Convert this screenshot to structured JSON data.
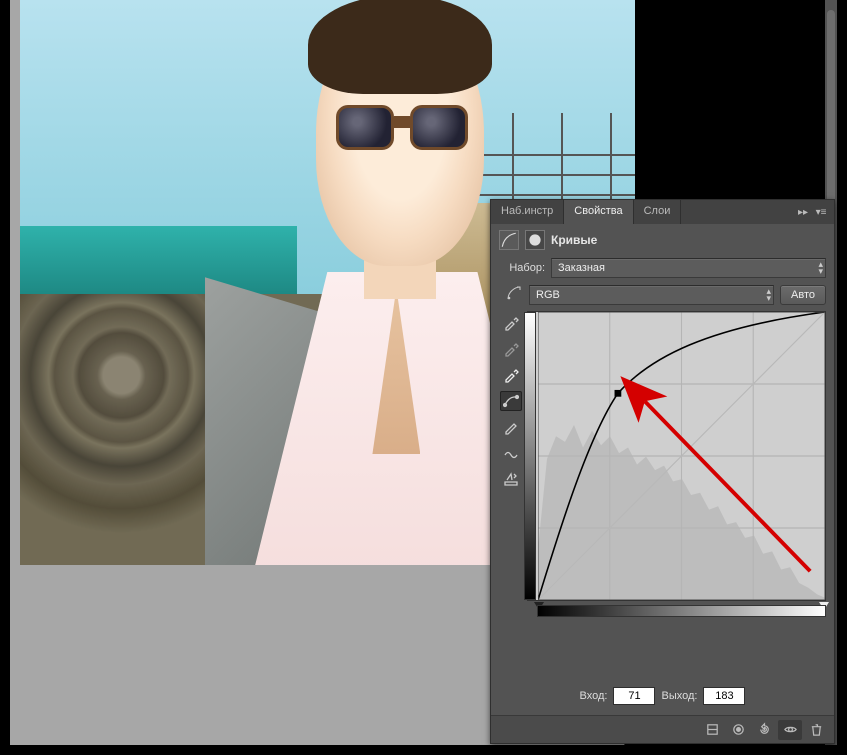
{
  "tabs": {
    "tool_presets": "Наб.инстр",
    "properties": "Свойства",
    "layers": "Слои"
  },
  "panel": {
    "title": "Кривые",
    "preset_label": "Набор:",
    "preset_value": "Заказная",
    "channel_value": "RGB",
    "auto_button": "Авто",
    "input_label": "Вход:",
    "input_value": "71",
    "output_label": "Выход:",
    "output_value": "183"
  },
  "chart_data": {
    "type": "line",
    "title": "Кривые",
    "xlabel": "Вход",
    "ylabel": "Выход",
    "xlim": [
      0,
      255
    ],
    "ylim": [
      0,
      255
    ],
    "grid": true,
    "series": [
      {
        "name": "RGB",
        "x": [
          0,
          20,
          40,
          55,
          71,
          90,
          110,
          140,
          170,
          200,
          230,
          255
        ],
        "y": [
          0,
          70,
          125,
          160,
          183,
          202,
          218,
          235,
          245,
          250,
          253,
          255
        ]
      }
    ],
    "control_points": [
      {
        "input": 0,
        "output": 0
      },
      {
        "input": 71,
        "output": 183,
        "selected": true
      },
      {
        "input": 255,
        "output": 255
      }
    ],
    "baseline": {
      "x": [
        0,
        255
      ],
      "y": [
        0,
        255
      ]
    },
    "histogram_hint": "grayscale histogram shown as backdrop, heavy in shadows/mids tapering to highlights"
  },
  "icons": {
    "curves": "curves-icon",
    "mask": "mask-icon",
    "flyout": "flyout-menu-icon",
    "minimize": "minimize-icon",
    "auto_select": "auto-select-icon",
    "eyedrop_black": "eyedropper-black-icon",
    "eyedrop_gray": "eyedropper-gray-icon",
    "eyedrop_white": "eyedropper-white-icon",
    "edit_points": "edit-points-icon",
    "draw_curve": "pencil-icon",
    "smooth": "smooth-icon",
    "clip_warning": "clip-warning-icon",
    "target_adjust": "target-adjust-icon",
    "prev_state": "prev-state-icon",
    "reset": "reset-icon",
    "visibility": "eye-icon",
    "trash": "trash-icon"
  }
}
